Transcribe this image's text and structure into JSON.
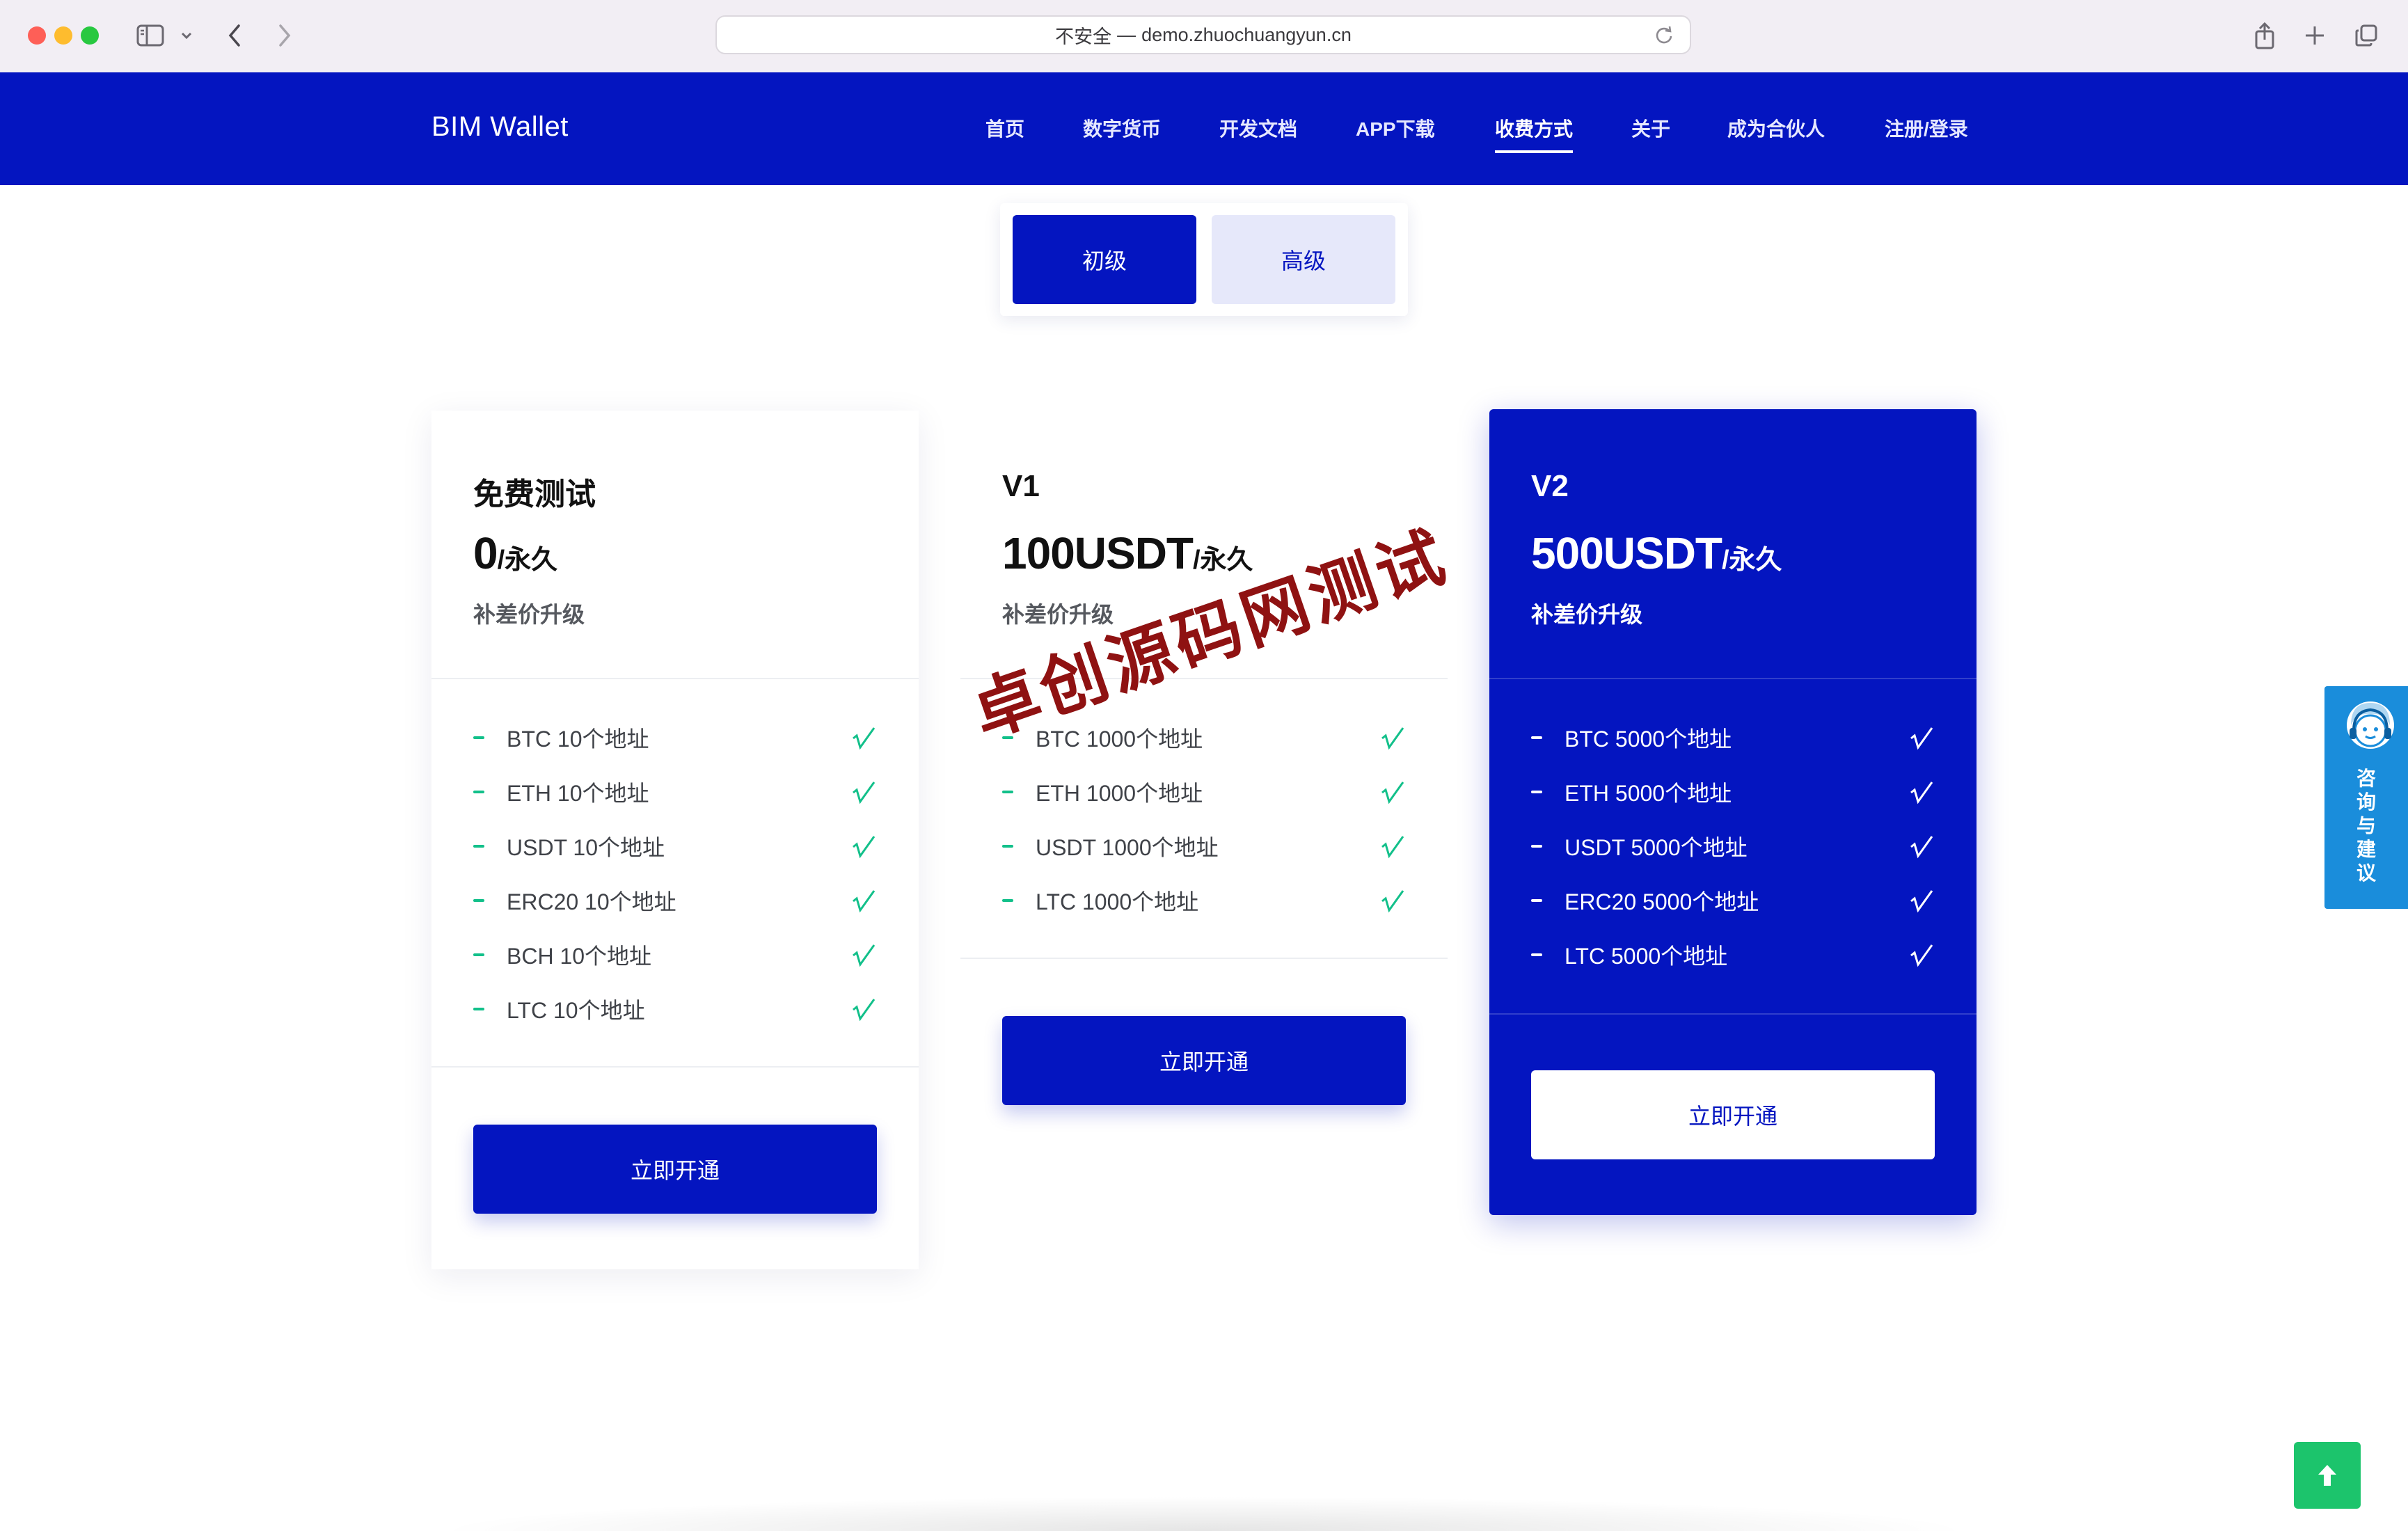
{
  "browser": {
    "url_security": "不安全",
    "url_separator": "—",
    "url_host": "demo.zhuochuangyun.cn"
  },
  "header": {
    "brand": "BIM Wallet",
    "nav": [
      {
        "label": "首页"
      },
      {
        "label": "数字货币"
      },
      {
        "label": "开发文档"
      },
      {
        "label": "APP下载"
      },
      {
        "label": "收费方式",
        "active": true
      },
      {
        "label": "关于"
      },
      {
        "label": "成为合伙人"
      },
      {
        "label": "注册/登录"
      }
    ]
  },
  "tabs": {
    "basic": "初级",
    "advanced": "高级",
    "selected": "初级"
  },
  "plans": [
    {
      "title": "免费测试",
      "price": "0",
      "unit": "/永久",
      "subtitle": "补差价升级",
      "features": [
        "BTC 10个地址",
        "ETH 10个地址",
        "USDT 10个地址",
        "ERC20 10个地址",
        "BCH 10个地址",
        "LTC 10个地址"
      ],
      "check": "√",
      "cta": "立即开通"
    },
    {
      "title": "V1",
      "price": "100USDT",
      "unit": "/永久",
      "subtitle": "补差价升级",
      "features": [
        "BTC 1000个地址",
        "ETH 1000个地址",
        "USDT 1000个地址",
        "LTC 1000个地址"
      ],
      "check": "√",
      "cta": "立即开通"
    },
    {
      "title": "V2",
      "price": "500USDT",
      "unit": "/永久",
      "subtitle": "补差价升级",
      "features": [
        "BTC 5000个地址",
        "ETH 5000个地址",
        "USDT 5000个地址",
        "ERC20 5000个地址",
        "LTC 5000个地址"
      ],
      "check": "√",
      "cta": "立即开通"
    }
  ],
  "watermark": "卓创源码网测试",
  "consult": {
    "label": "咨询与建议"
  },
  "colors": {
    "primary": "#0415c0",
    "accent_green": "#12c08a",
    "consult_blue": "#1a8ddb",
    "backtop_green": "#1cc46c"
  },
  "icons": {
    "back_to_top": "arrow-up-icon",
    "check": "check-icon"
  }
}
